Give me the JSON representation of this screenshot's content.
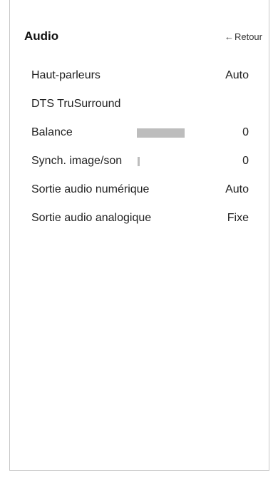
{
  "header": {
    "title": "Audio",
    "back_label": "Retour",
    "back_arrow": "←"
  },
  "menu": {
    "items": [
      {
        "label": "Haut-parleurs",
        "value": "Auto"
      },
      {
        "label": "DTS TruSurround",
        "value": ""
      },
      {
        "label": "Balance",
        "value": "0",
        "slider_fill_fraction": 0.5
      },
      {
        "label": "Synch. image/son",
        "value": "0",
        "slider_fill_fraction": 0.02
      },
      {
        "label": "Sortie audio numérique",
        "value": "Auto"
      },
      {
        "label": "Sortie audio analogique",
        "value": "Fixe"
      }
    ]
  },
  "colors": {
    "slider_fill": "#bdbdbd",
    "slider_track": "#ffffff",
    "panel_border": "#c8c8c8"
  }
}
